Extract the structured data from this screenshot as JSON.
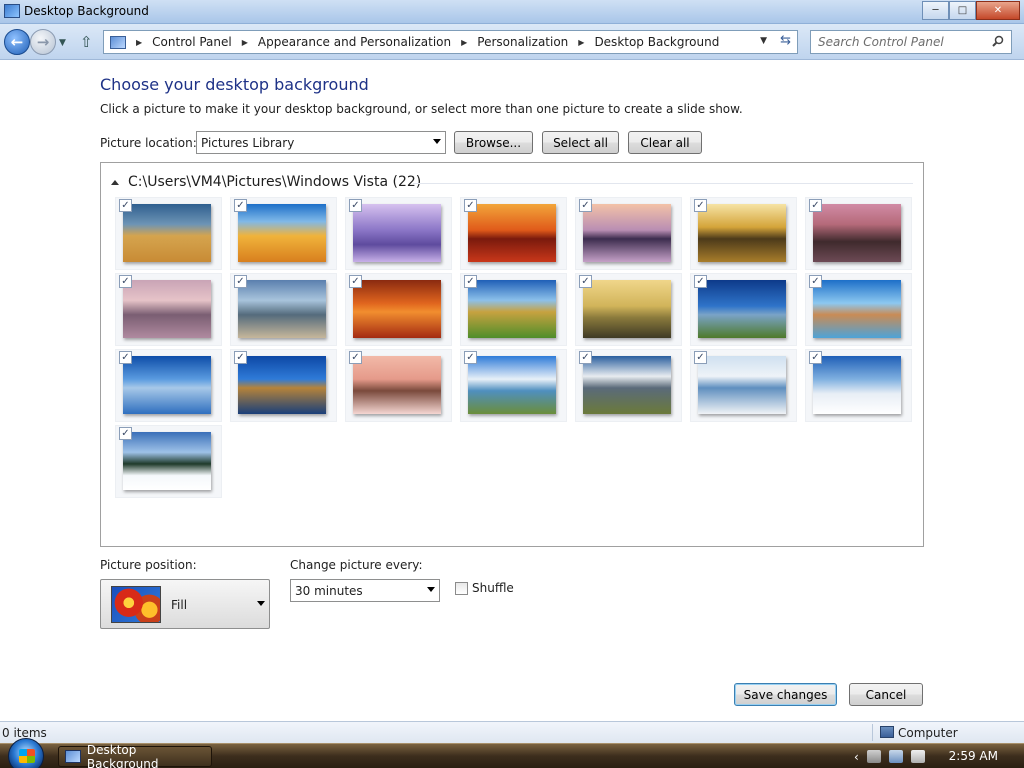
{
  "window": {
    "title": "Desktop Background",
    "buttons": {
      "minimize": "─",
      "maximize": "□",
      "close": "✕"
    }
  },
  "nav": {
    "breadcrumbs": [
      "Control Panel",
      "Appearance and Personalization",
      "Personalization",
      "Desktop Background"
    ],
    "search_placeholder": "Search Control Panel"
  },
  "main": {
    "heading": "Choose your desktop background",
    "description": "Click a picture to make it your desktop background, or select more than one picture to create a slide show.",
    "picture_location_label": "Picture location:",
    "picture_location_value": "Pictures Library",
    "browse_label": "Browse...",
    "select_all_label": "Select all",
    "clear_all_label": "Clear all",
    "group_title": "C:\\Users\\VM4\\Pictures\\Windows Vista (22)",
    "thumbnails": [
      {
        "checked": "✓",
        "style": "linear-gradient(#2f5f8f 0%, #6d94b5 35%, #d5a44e 55%, #c88b35 100%)"
      },
      {
        "checked": "✓",
        "style": "linear-gradient(#1d6fc8 0%, #7fb8e8 30%, #f0b33b 55%, #d87f1e 100%)"
      },
      {
        "checked": "✓",
        "style": "linear-gradient(#d6c1ef 0%, #8b76c7 45%, #5e4b9e 70%, #c8b0e8 100%)"
      },
      {
        "checked": "✓",
        "style": "linear-gradient(#f2a53a 0%, #e05a1a 45%, #7a1a0d 60%, #c9371a 100%)"
      },
      {
        "checked": "✓",
        "style": "linear-gradient(#f3c2a7 0%, #b98eb3 45%, #3c2c4e 60%, #c5a0c7 100%)"
      },
      {
        "checked": "✓",
        "style": "linear-gradient(#f6e3a5 0%, #d4a43a 40%, #4c3a1a 60%, #a87d2a 100%)"
      },
      {
        "checked": "✓",
        "style": "linear-gradient(#d18ba5 0%, #b56a7a 35%, #3f2a2d 65%, #6d4a55 100%)"
      },
      {
        "checked": "✓",
        "style": "linear-gradient(#c9a4b6 0%, #e6c3c8 35%, #7a5e72 60%, #b08aa0 100%)"
      },
      {
        "checked": "✓",
        "style": "linear-gradient(#5a7fae 0%, #a8c4dc 35%, #546b7c 60%, #c6b79b 100%)"
      },
      {
        "checked": "✓",
        "style": "linear-gradient(#8a2a10 0%, #e0651e 40%, #f28e2f 55%, #a32a12 100%)"
      },
      {
        "checked": "✓",
        "style": "linear-gradient(#1f5fb7 0%, #8cc0ea 35%, #c7a240 55%, #4f8e2a 100%)"
      },
      {
        "checked": "✓",
        "style": "linear-gradient(#f0d68a 0%, #d1b45a 45%, #8a7a3c 65%, #3f3a25 100%)"
      },
      {
        "checked": "✓",
        "style": "linear-gradient(#0d3a8a 0%, #2f74c9 45%, #7aa3c7 60%, #4e7a2a 100%)"
      },
      {
        "checked": "✓",
        "style": "linear-gradient(#1d6fc8 0%, #8cc8f0 40%, #c98b55 60%, #4ea3d8 100%)"
      },
      {
        "checked": "✓",
        "style": "linear-gradient(#0e4da8 0%, #5a9be0 40%, #a7c8e8 55%, #2f6fbf 100%)"
      },
      {
        "checked": "✓",
        "style": "linear-gradient(#0d48a5 0%, #2f7bd8 40%, #b5833a 55%, #1a3f7a 100%)"
      },
      {
        "checked": "✓",
        "style": "linear-gradient(#f2b9a8 0%, #e59a8a 40%, #7a4a3c 60%, #f5d6d2 100%)"
      },
      {
        "checked": "✓",
        "style": "linear-gradient(#2f7bd8 0%, #e8f0f8 40%, #4f8fbf 60%, #6b8e3a 100%)"
      },
      {
        "checked": "✓",
        "style": "linear-gradient(#2a5f9e 0%, #e8ecf0 35%, #5a6a7a 55%, #6b7a3a 100%)"
      },
      {
        "checked": "✓",
        "style": "linear-gradient(#cfe0f0 0%, #eef3f8 35%, #5f8fbf 55%, #f0f3f6 100%)"
      },
      {
        "checked": "✓",
        "style": "linear-gradient(#1f5fb7 0%, #7fb0e0 40%, #e8eef5 65%, #ffffff 100%)"
      },
      {
        "checked": "✓",
        "style": "linear-gradient(#3a6fb8 0%, #9ec2e8 35%, #1f3a2a 55%, #f5f8fb 75%, #ffffff 100%)"
      }
    ],
    "picture_position_label": "Picture position:",
    "picture_position_value": "Fill",
    "change_every_label": "Change picture every:",
    "change_every_value": "30 minutes",
    "shuffle_label": "Shuffle",
    "save_label": "Save changes",
    "cancel_label": "Cancel"
  },
  "status": {
    "items": "0 items",
    "location": "Computer"
  },
  "taskbar": {
    "window_button": "Desktop Background",
    "tray_chevron": "‹",
    "clock": "2:59 AM"
  }
}
